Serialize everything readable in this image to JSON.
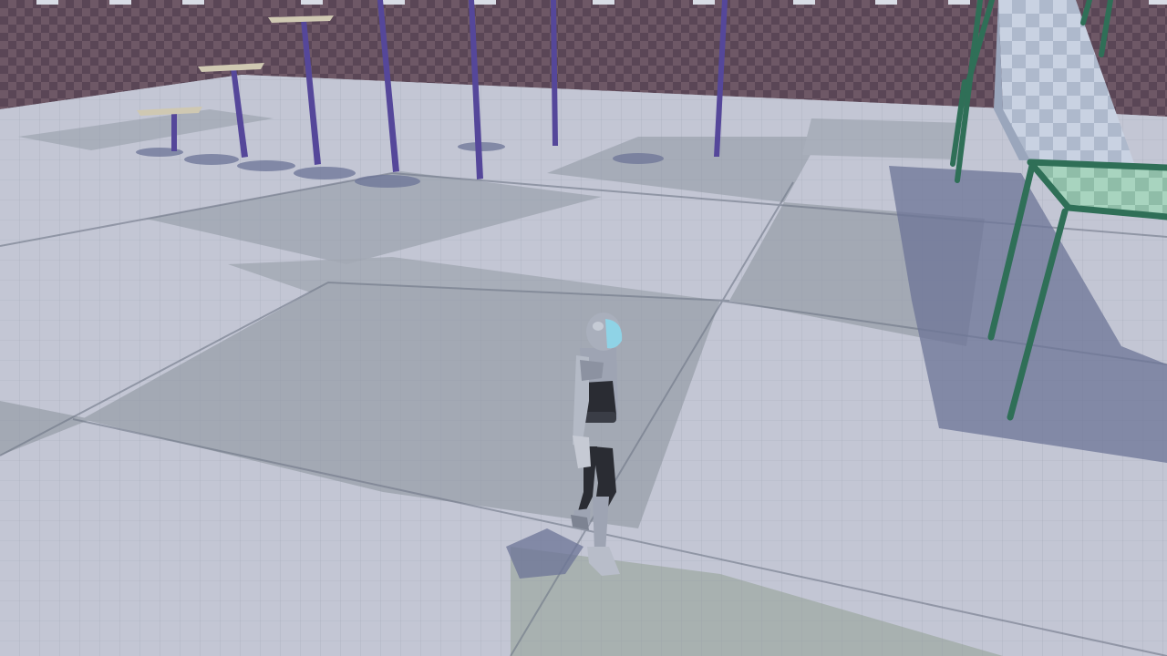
{
  "scene": {
    "environment": "third-person-test-level",
    "colors": {
      "wall_light": "#6e5866",
      "wall_dark": "#5a4656",
      "wall_trim": "#d9dde6",
      "floor_light": "#c3c6d4",
      "floor_dark": "#a3a9b4",
      "floor_line": "#8e94a3",
      "pole": "#55479a",
      "platform_top": "#cfc8b2",
      "shadow": "#6c7497",
      "stair_frame": "#2f6f57",
      "stair_top": "#9fc9b6",
      "ramp": "#b9c3d6",
      "character_body": "#9ea4b3",
      "character_dark": "#2a2c33",
      "visor": "#8fd3e6"
    }
  }
}
